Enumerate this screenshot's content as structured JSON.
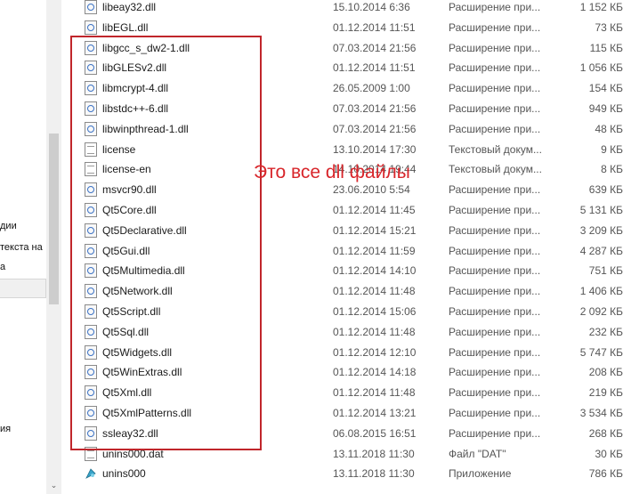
{
  "left_pane": {
    "item_1": "дии",
    "item_2": "текста на",
    "item_3": "а",
    "item_4": "ия"
  },
  "scrollbar": {
    "down_arrow": "⌄"
  },
  "files": [
    {
      "name": "libeay32.dll",
      "date": "15.10.2014 6:36",
      "type": "Расширение при...",
      "size": "1 152 КБ",
      "icon": "dll-icon"
    },
    {
      "name": "libEGL.dll",
      "date": "01.12.2014 11:51",
      "type": "Расширение при...",
      "size": "73 КБ",
      "icon": "dll-icon"
    },
    {
      "name": "libgcc_s_dw2-1.dll",
      "date": "07.03.2014 21:56",
      "type": "Расширение при...",
      "size": "115 КБ",
      "icon": "dll-icon"
    },
    {
      "name": "libGLESv2.dll",
      "date": "01.12.2014 11:51",
      "type": "Расширение при...",
      "size": "1 056 КБ",
      "icon": "dll-icon"
    },
    {
      "name": "libmcrypt-4.dll",
      "date": "26.05.2009 1:00",
      "type": "Расширение при...",
      "size": "154 КБ",
      "icon": "dll-icon"
    },
    {
      "name": "libstdc++-6.dll",
      "date": "07.03.2014 21:56",
      "type": "Расширение при...",
      "size": "949 КБ",
      "icon": "dll-icon"
    },
    {
      "name": "libwinpthread-1.dll",
      "date": "07.03.2014 21:56",
      "type": "Расширение при...",
      "size": "48 КБ",
      "icon": "dll-icon"
    },
    {
      "name": "license",
      "date": "13.10.2014 17:30",
      "type": "Текстовый докум...",
      "size": "9 КБ",
      "icon": "text-file-icon"
    },
    {
      "name": "license-en",
      "date": "14.10.2014 19:44",
      "type": "Текстовый докум...",
      "size": "8 КБ",
      "icon": "text-file-icon"
    },
    {
      "name": "msvcr90.dll",
      "date": "23.06.2010 5:54",
      "type": "Расширение при...",
      "size": "639 КБ",
      "icon": "dll-icon"
    },
    {
      "name": "Qt5Core.dll",
      "date": "01.12.2014 11:45",
      "type": "Расширение при...",
      "size": "5 131 КБ",
      "icon": "dll-icon"
    },
    {
      "name": "Qt5Declarative.dll",
      "date": "01.12.2014 15:21",
      "type": "Расширение при...",
      "size": "3 209 КБ",
      "icon": "dll-icon"
    },
    {
      "name": "Qt5Gui.dll",
      "date": "01.12.2014 11:59",
      "type": "Расширение при...",
      "size": "4 287 КБ",
      "icon": "dll-icon"
    },
    {
      "name": "Qt5Multimedia.dll",
      "date": "01.12.2014 14:10",
      "type": "Расширение при...",
      "size": "751 КБ",
      "icon": "dll-icon"
    },
    {
      "name": "Qt5Network.dll",
      "date": "01.12.2014 11:48",
      "type": "Расширение при...",
      "size": "1 406 КБ",
      "icon": "dll-icon"
    },
    {
      "name": "Qt5Script.dll",
      "date": "01.12.2014 15:06",
      "type": "Расширение при...",
      "size": "2 092 КБ",
      "icon": "dll-icon"
    },
    {
      "name": "Qt5Sql.dll",
      "date": "01.12.2014 11:48",
      "type": "Расширение при...",
      "size": "232 КБ",
      "icon": "dll-icon"
    },
    {
      "name": "Qt5Widgets.dll",
      "date": "01.12.2014 12:10",
      "type": "Расширение при...",
      "size": "5 747 КБ",
      "icon": "dll-icon"
    },
    {
      "name": "Qt5WinExtras.dll",
      "date": "01.12.2014 14:18",
      "type": "Расширение при...",
      "size": "208 КБ",
      "icon": "dll-icon"
    },
    {
      "name": "Qt5Xml.dll",
      "date": "01.12.2014 11:48",
      "type": "Расширение при...",
      "size": "219 КБ",
      "icon": "dll-icon"
    },
    {
      "name": "Qt5XmlPatterns.dll",
      "date": "01.12.2014 13:21",
      "type": "Расширение при...",
      "size": "3 534 КБ",
      "icon": "dll-icon"
    },
    {
      "name": "ssleay32.dll",
      "date": "06.08.2015 16:51",
      "type": "Расширение при...",
      "size": "268 КБ",
      "icon": "dll-icon"
    },
    {
      "name": "unins000.dat",
      "date": "13.11.2018 11:30",
      "type": "Файл \"DAT\"",
      "size": "30 КБ",
      "icon": "dat-file-icon"
    },
    {
      "name": "unins000",
      "date": "13.11.2018 11:30",
      "type": "Приложение",
      "size": "786 КБ",
      "icon": "app-icon"
    }
  ],
  "annotation": {
    "text": "Это все dll файлы",
    "color": "#d8262b"
  }
}
